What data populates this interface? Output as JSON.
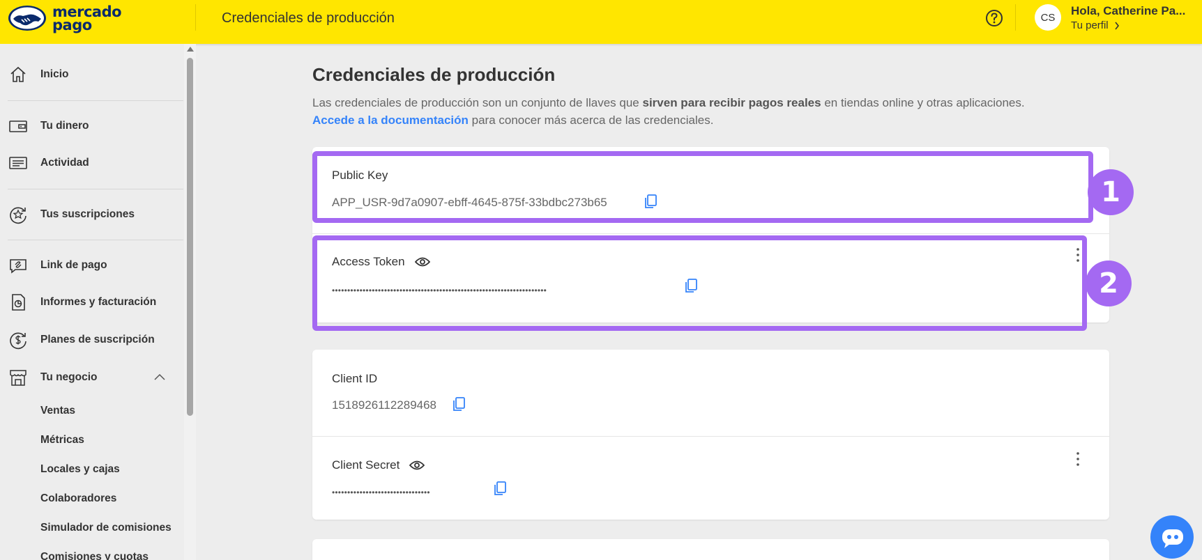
{
  "topbar": {
    "logo_line1": "mercado",
    "logo_line2": "pago",
    "title": "Credenciales de producción",
    "avatar_initials": "CS",
    "greeting": "Hola, Catherine Pa...",
    "profile_link": "Tu perfil"
  },
  "sidebar": {
    "items": [
      {
        "label": "Inicio",
        "icon": "home-icon"
      },
      {
        "label": "Tu dinero",
        "icon": "wallet-icon"
      },
      {
        "label": "Actividad",
        "icon": "list-icon"
      },
      {
        "label": "Tus suscripciones",
        "icon": "star-refresh-icon"
      },
      {
        "label": "Link de pago",
        "icon": "link-chat-icon"
      },
      {
        "label": "Informes y facturación",
        "icon": "report-icon"
      },
      {
        "label": "Planes de suscripción",
        "icon": "dollar-refresh-icon"
      },
      {
        "label": "Tu negocio",
        "icon": "store-icon"
      }
    ],
    "sub_items": [
      "Ventas",
      "Métricas",
      "Locales y cajas",
      "Colaboradores",
      "Simulador de comisiones",
      "Comisiones y cuotas"
    ]
  },
  "main": {
    "title": "Credenciales de producción",
    "desc_part1": "Las credenciales de producción son un conjunto de llaves que ",
    "desc_bold": "sirven para recibir pagos reales",
    "desc_part2": " en tiendas online y otras aplicaciones.",
    "doc_link": "Accede a la documentación",
    "desc_part3": " para conocer más acerca de las credenciales.",
    "public_key": {
      "label": "Public Key",
      "value": "APP_USR-9d7a0907-ebff-4645-875f-33bdbc273b65"
    },
    "access_token": {
      "label": "Access Token",
      "value": "••••••••••••••••••••••••••••••••••••••••••••••••••••••••••••••••••••••"
    },
    "client_id": {
      "label": "Client ID",
      "value": "1518926112289468"
    },
    "client_secret": {
      "label": "Client Secret",
      "value": "••••••••••••••••••••••••••••••••"
    }
  },
  "annotations": {
    "badge1": "1",
    "badge2": "2"
  },
  "colors": {
    "brand_yellow": "#ffe600",
    "accent_blue": "#3483fa",
    "highlight_purple": "#a469f2"
  }
}
